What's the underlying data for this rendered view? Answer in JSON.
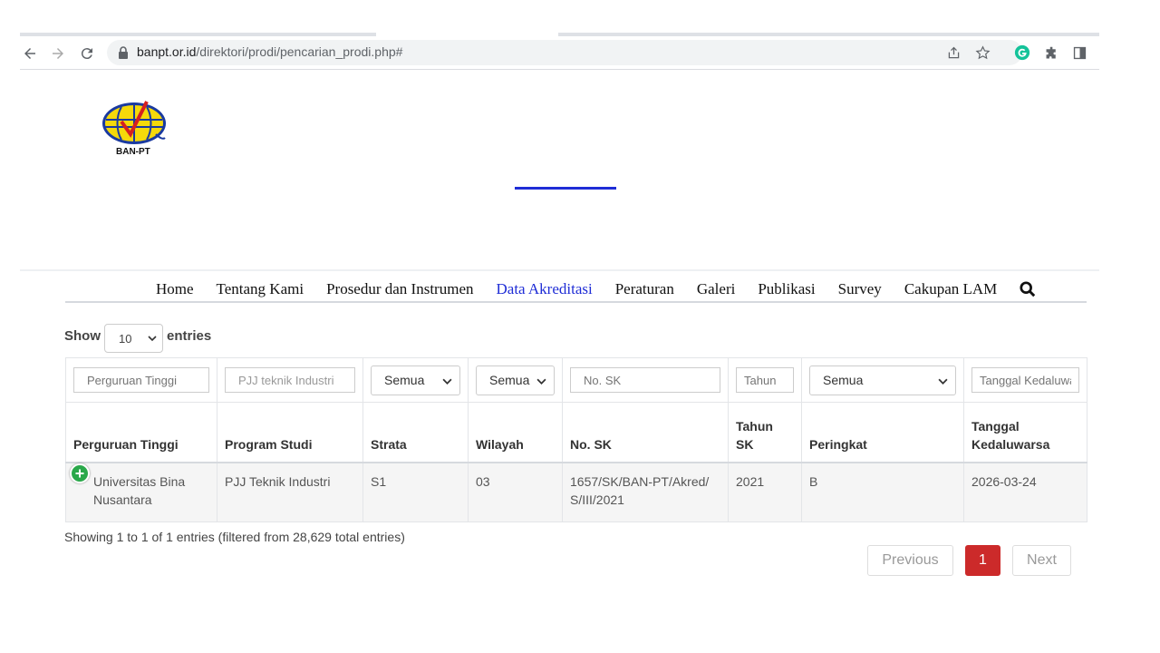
{
  "browser": {
    "url_domain": "banpt.or.id",
    "url_path": "/direktori/prodi/pencarian_prodi.php#"
  },
  "logo": {
    "text": "BAN-PT"
  },
  "nav": {
    "items": [
      {
        "label": "Home",
        "active": false
      },
      {
        "label": "Tentang Kami",
        "active": false
      },
      {
        "label": "Prosedur dan Instrumen",
        "active": false
      },
      {
        "label": "Data Akreditasi",
        "active": true
      },
      {
        "label": "Peraturan",
        "active": false
      },
      {
        "label": "Galeri",
        "active": false
      },
      {
        "label": "Publikasi",
        "active": false
      },
      {
        "label": "Survey",
        "active": false
      },
      {
        "label": "Cakupan LAM",
        "active": false
      }
    ],
    "active_color": "#1f2dd6"
  },
  "table_controls": {
    "show_label": "Show",
    "length_value": "10",
    "entries_label": "entries"
  },
  "filters": {
    "perguruan_tinggi_placeholder": "Perguruan Tinggi",
    "program_studi_value": "PJJ teknik Industri",
    "strata_value": "Semua",
    "wilayah_value": "Semua",
    "no_sk_placeholder": "No. SK",
    "tahun_placeholder": "Tahun",
    "peringkat_value": "Semua",
    "tanggal_placeholder": "Tanggal Kedaluwarsa"
  },
  "columns": {
    "perguruan_tinggi": "Perguruan Tinggi",
    "program_studi": "Program Studi",
    "strata": "Strata",
    "wilayah": "Wilayah",
    "no_sk": "No. SK",
    "tahun_sk": "Tahun SK",
    "peringkat": "Peringkat",
    "tanggal_kedaluwarsa": "Tanggal Kedaluwarsa"
  },
  "rows": [
    {
      "perguruan_tinggi": "Universitas Bina Nusantara",
      "program_studi": "PJJ Teknik Industri",
      "strata": "S1",
      "wilayah": "03",
      "no_sk": "1657/SK/BAN-PT/Akred/S/III/2021",
      "tahun_sk": "2021",
      "peringkat": "B",
      "tanggal_kedaluwarsa": "2026-03-24"
    }
  ],
  "info_text": "Showing 1 to 1 of 1 entries (filtered from 28,629 total entries)",
  "pagination": {
    "previous": "Previous",
    "current": "1",
    "next": "Next",
    "current_color": "#cc2a2a"
  }
}
